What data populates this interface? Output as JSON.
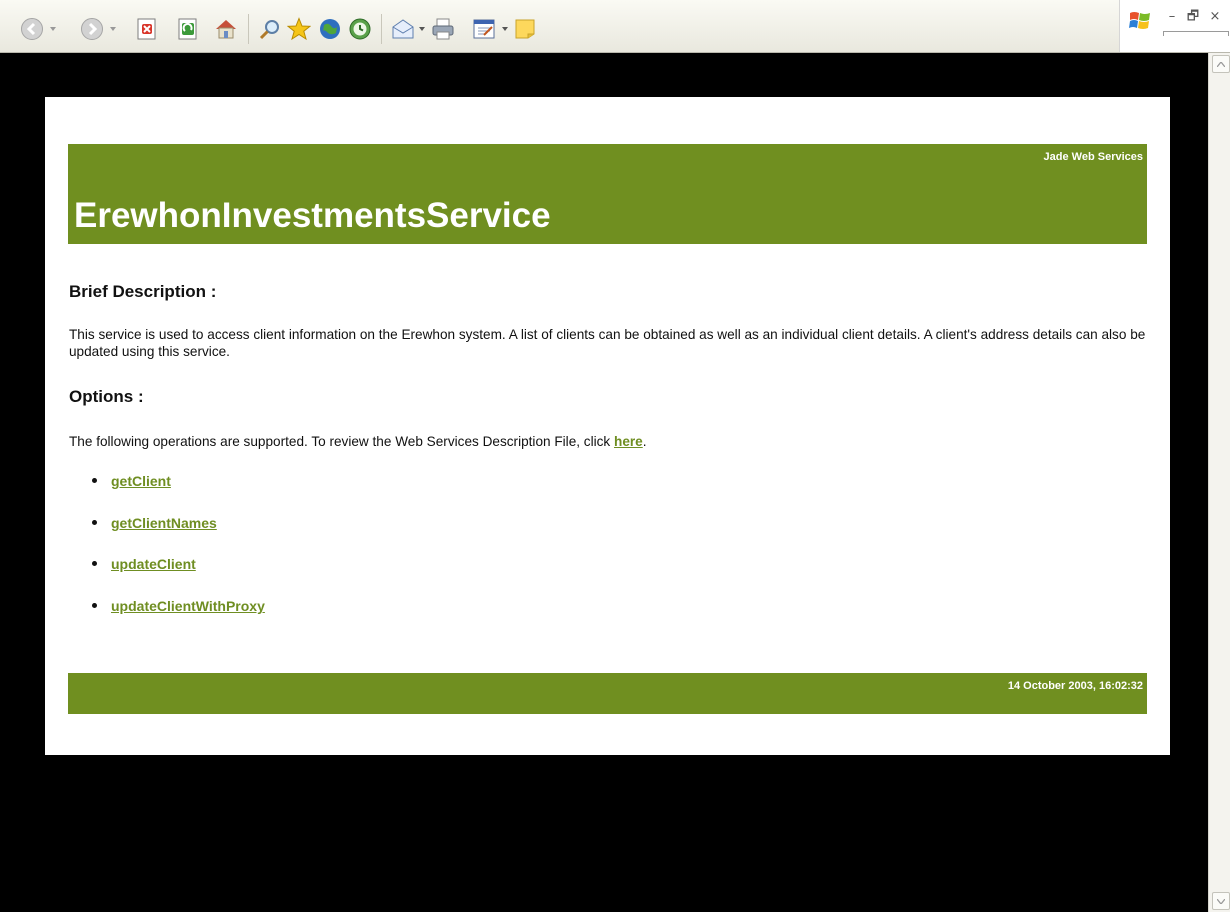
{
  "toolbar": {
    "buttons": [
      {
        "name": "back-icon"
      },
      {
        "name": "forward-icon"
      },
      {
        "name": "stop-icon"
      },
      {
        "name": "refresh-icon"
      },
      {
        "name": "home-icon"
      },
      {
        "name": "search-icon"
      },
      {
        "name": "favorites-icon"
      },
      {
        "name": "media-icon"
      },
      {
        "name": "history-icon"
      },
      {
        "name": "mail-icon"
      },
      {
        "name": "print-icon"
      },
      {
        "name": "edit-icon"
      },
      {
        "name": "messenger-icon"
      }
    ]
  },
  "window_controls": {
    "logo": "windows-flag-icon",
    "minimize": "–",
    "restore": "🗗",
    "close": "×"
  },
  "page": {
    "brand": "Jade Web Services",
    "title": "ErewhonInvestmentsService",
    "brief_heading": "Brief Description :",
    "brief_text": "This service is used to access client information on the Erewhon system. A list of clients can be obtained as well as an individual client details. A client's address details can also be updated using this service.",
    "options_heading": "Options :",
    "options_text_before": "The following operations are supported. To review the Web Services Description File, click ",
    "options_link": "here",
    "options_text_after": ".",
    "operations": [
      "getClient",
      "getClientNames",
      "updateClient",
      "updateClientWithProxy"
    ],
    "timestamp": "14 October 2003, 16:02:32"
  },
  "colors": {
    "band": "#708f20",
    "link": "#6f8e22",
    "background": "#000000",
    "page": "#ffffff"
  }
}
